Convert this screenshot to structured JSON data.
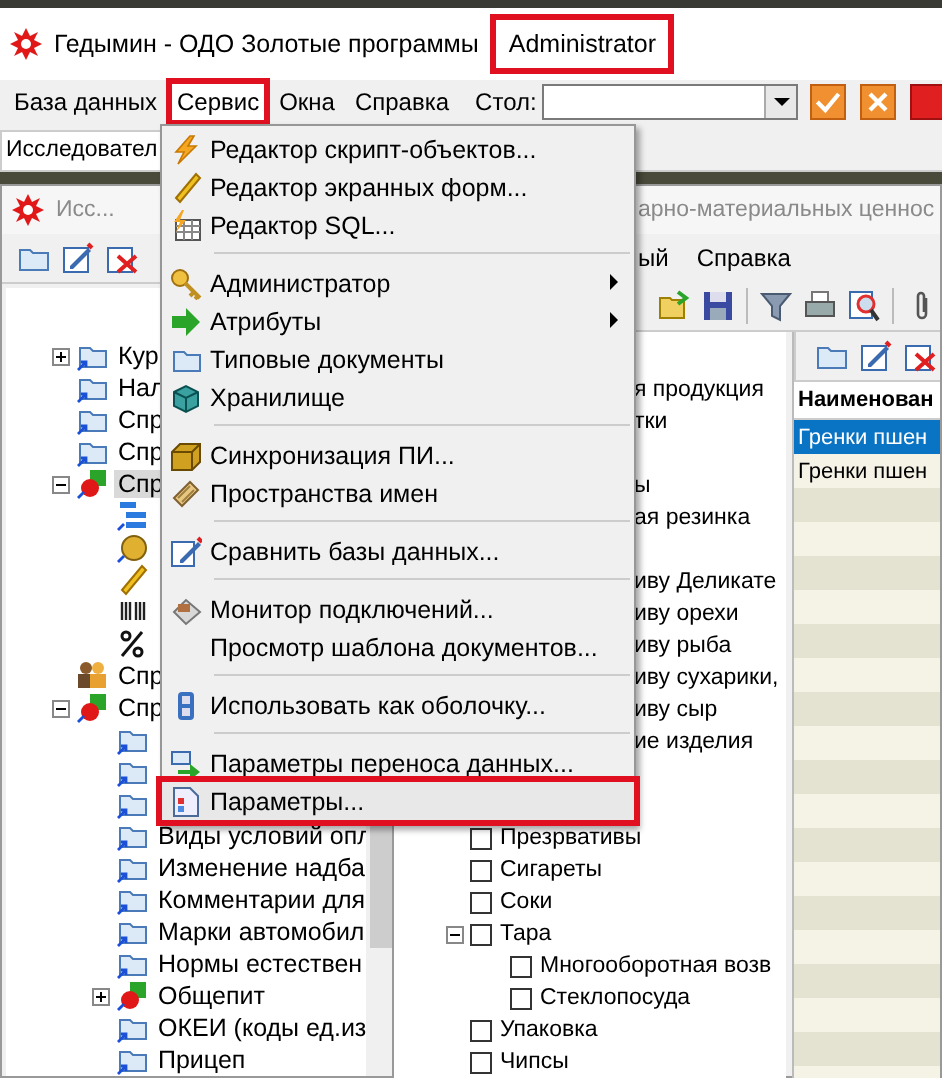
{
  "window": {
    "title": "Гедымин - ОДО Золотые программы",
    "user": {
      "label": "Administrator",
      "highlighted": true
    }
  },
  "menu": [
    {
      "label": "База данных",
      "selected": false
    },
    {
      "label": "Сервис",
      "selected": true
    },
    {
      "label": "Окна",
      "selected": false
    },
    {
      "label": "Справка",
      "selected": false
    }
  ],
  "table_selector": {
    "label": "Стол:"
  },
  "tabs": [
    {
      "label": "Исследовател",
      "selected": true
    }
  ],
  "left_window": {
    "title": "Исс...",
    "tree": [
      {
        "kind": "folder",
        "label": "Кур",
        "expanded": false
      },
      {
        "kind": "folder",
        "label": "Нал"
      },
      {
        "kind": "folder",
        "label": "Спр"
      },
      {
        "kind": "folder",
        "label": "Спр"
      },
      {
        "kind": "module",
        "label": "Спр",
        "expanded": true,
        "selected": true,
        "children": [
          {
            "kind": "list"
          },
          {
            "kind": "coin"
          },
          {
            "kind": "ruler"
          },
          {
            "kind": "barcode"
          },
          {
            "kind": "percent"
          }
        ]
      },
      {
        "kind": "people",
        "label": "Спр"
      },
      {
        "kind": "module",
        "label": "Спр",
        "expanded": true,
        "selected": false,
        "children": [
          {
            "kind": "folder"
          },
          {
            "kind": "folder"
          },
          {
            "kind": "folder"
          },
          {
            "kind": "folder",
            "label": "Виды условий опл"
          },
          {
            "kind": "folder",
            "label": "Изменение надба"
          },
          {
            "kind": "folder",
            "label": "Комментарии для"
          },
          {
            "kind": "folder",
            "label": "Марки автомобил"
          },
          {
            "kind": "folder",
            "label": "Нормы естествен"
          },
          {
            "kind": "module",
            "label": "Общепит",
            "expanded": false
          },
          {
            "kind": "folder",
            "label": "ОКЕИ (коды ед.из"
          },
          {
            "kind": "folder",
            "label": "Прицеп"
          }
        ]
      }
    ]
  },
  "right_window": {
    "title": "арно-материальных ценнос",
    "menu": [
      "ый",
      "Справка"
    ],
    "tree": [
      {
        "kind": "row",
        "label": "я продукция"
      },
      {
        "kind": "row",
        "label": "тки"
      },
      {
        "kind": "row"
      },
      {
        "kind": "row",
        "label": "ы"
      },
      {
        "kind": "row",
        "label": "ая резинка"
      },
      {
        "kind": "row"
      },
      {
        "kind": "row",
        "label": "иву Деликате"
      },
      {
        "kind": "row",
        "label": "иву орехи"
      },
      {
        "kind": "row",
        "label": "иву рыба"
      },
      {
        "kind": "row",
        "label": "иву сухарики,"
      },
      {
        "kind": "row",
        "label": "иву сыр"
      },
      {
        "kind": "row",
        "label": "ие изделия"
      },
      {
        "kind": "row"
      },
      {
        "kind": "row"
      },
      {
        "kind": "checkbox",
        "label": "Презрвативы",
        "checked": false
      },
      {
        "kind": "checkbox",
        "label": "Сигареты",
        "checked": false
      },
      {
        "kind": "checkbox",
        "label": "Соки",
        "checked": false
      },
      {
        "kind": "checkbox",
        "label": "Тара",
        "checked": false,
        "expanded": true,
        "children": [
          {
            "kind": "checkbox",
            "label": "Многооборотная возв",
            "checked": false
          },
          {
            "kind": "checkbox",
            "label": "Стеклопосуда",
            "checked": false
          }
        ]
      },
      {
        "kind": "checkbox",
        "label": "Упаковка",
        "checked": false
      },
      {
        "kind": "checkbox",
        "label": "Чипсы",
        "checked": false
      }
    ],
    "grid": {
      "columns": [
        "Наименован"
      ],
      "rows": [
        {
          "cells": [
            "Гренки пшен"
          ],
          "selected": true
        },
        {
          "cells": [
            "Гренки пшен"
          ],
          "selected": false
        }
      ]
    }
  },
  "dropdown": {
    "items": [
      {
        "kind": "item",
        "label": "Редактор скрипт-объектов...",
        "highlighted": false
      },
      {
        "kind": "item",
        "label": "Редактор экранных форм...",
        "highlighted": false
      },
      {
        "kind": "item",
        "label": "Редактор SQL...",
        "highlighted": false
      },
      {
        "kind": "separator"
      },
      {
        "kind": "item",
        "label": "Администратор",
        "submenu": true,
        "highlighted": false
      },
      {
        "kind": "item",
        "label": "Атрибуты",
        "submenu": true,
        "highlighted": false
      },
      {
        "kind": "item",
        "label": "Типовые документы",
        "highlighted": false
      },
      {
        "kind": "item",
        "label": "Хранилище",
        "highlighted": false
      },
      {
        "kind": "separator"
      },
      {
        "kind": "item",
        "label": "Синхронизация ПИ...",
        "highlighted": false
      },
      {
        "kind": "item",
        "label": "Пространства имен",
        "highlighted": false
      },
      {
        "kind": "separator"
      },
      {
        "kind": "item",
        "label": "Сравнить базы данных...",
        "highlighted": false
      },
      {
        "kind": "separator"
      },
      {
        "kind": "item",
        "label": "Монитор подключений...",
        "highlighted": false
      },
      {
        "kind": "item",
        "label": "Просмотр шаблона документов...",
        "highlighted": false
      },
      {
        "kind": "separator"
      },
      {
        "kind": "item",
        "label": "Использовать как оболочку...",
        "highlighted": false
      },
      {
        "kind": "separator"
      },
      {
        "kind": "item",
        "label": "Параметры переноса данных...",
        "highlighted": false
      },
      {
        "kind": "item",
        "label": "Параметры...",
        "highlighted": true
      }
    ]
  }
}
